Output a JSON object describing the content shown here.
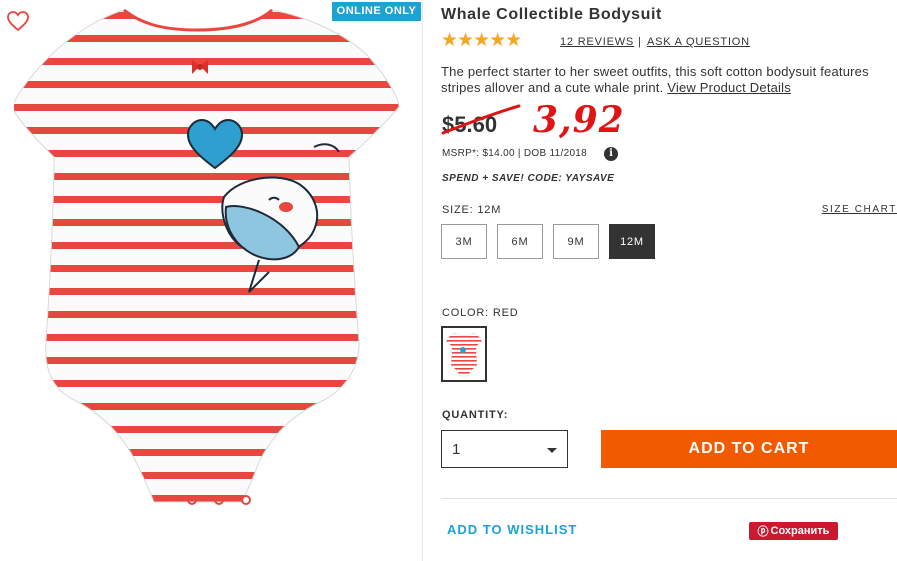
{
  "badge": "ONLINE ONLY",
  "icons": {
    "heart": "heart-outline-icon",
    "star": "star-icon",
    "info": "info-icon",
    "caret": "chevron-down-icon",
    "pin": "pinterest-icon"
  },
  "product": {
    "title": "Whale Collectible Bodysuit",
    "rating": 5,
    "stars": "★★★★★",
    "reviews_label": "12 REVIEWS",
    "separator": "|",
    "ask_label": "ASK A QUESTION",
    "description": "The perfect starter to her sweet outfits, this soft cotton bodysuit features stripes allover and a cute whale print. ",
    "details_link": "View Product Details",
    "old_price": "$5.60",
    "new_price": "3,92",
    "msrp": "MSRP*: $14.00 | DOB 11/2018",
    "info_glyph": "i",
    "promo": "SPEND + SAVE! CODE: YAYSAVE"
  },
  "size": {
    "label": "SIZE: 12M",
    "chart_label": "SIZE CHART",
    "options": [
      "3M",
      "6M",
      "9M",
      "12M"
    ],
    "selected": "12M"
  },
  "color": {
    "label": "COLOR: RED"
  },
  "quantity": {
    "label": "QUANTITY:",
    "value": "1"
  },
  "actions": {
    "add_to_cart": "ADD TO CART",
    "wishlist": "ADD TO WISHLIST",
    "pin_glyph": "ⓟ",
    "save": "Сохранить"
  },
  "colors": {
    "accent_blue": "#1ba3d6",
    "cart_orange": "#f25a00",
    "price_red": "#e01414",
    "star_gold": "#f5a623",
    "save_red": "#cb1a2f",
    "stripe_red": "#e8473f"
  }
}
